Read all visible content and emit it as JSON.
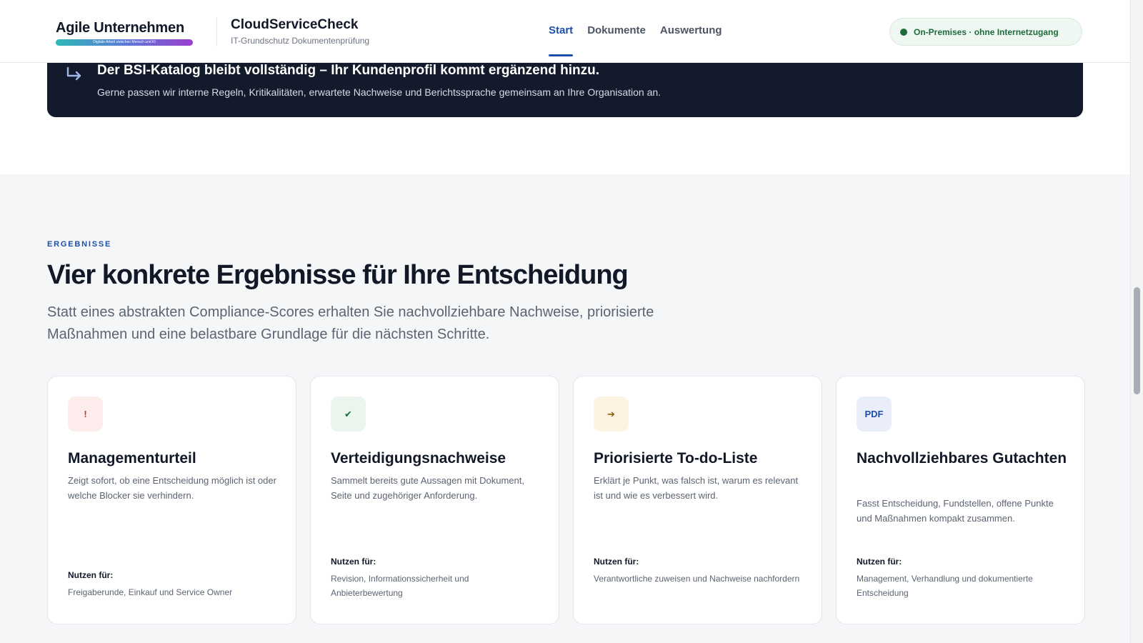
{
  "header": {
    "brand": {
      "name": "Agile Unternehmen",
      "tagline": "Digitale Arbeit zwischen Mensch und KI"
    },
    "product": {
      "name": "CloudServiceCheck",
      "subtitle": "IT-Grundschutz Dokumentenprüfung"
    },
    "nav": [
      {
        "label": "Start",
        "active": true
      },
      {
        "label": "Dokumente",
        "active": false
      },
      {
        "label": "Auswertung",
        "active": false
      }
    ],
    "status": {
      "label": "On-Premises · ohne Internetzugang",
      "color": "#1f6b3b"
    }
  },
  "banner": {
    "title": "Der BSI-Katalog bleibt vollständig – Ihr Kundenprofil kommt ergänzend hinzu.",
    "text": "Gerne passen wir interne Regeln, Kritikalitäten, erwartete Nachweise und Berichtssprache gemeinsam an Ihre Organisation an."
  },
  "results": {
    "eyebrow": "ERGEBNISSE",
    "title": "Vier konkrete Ergebnisse für Ihre Entscheidung",
    "lead": "Statt eines abstrakten Compliance-Scores erhalten Sie nachvollziehbare Nachweise, priorisierte Maßnahmen und eine belastbare Grundlage für die nächsten Schritte.",
    "cards": [
      {
        "icon": "!",
        "icon_name": "exclamation-icon",
        "icon_bg": "#fdecec",
        "icon_color": "#c0392b",
        "title": "Managementurteil",
        "description": "Zeigt sofort, ob eine Entscheidung möglich ist oder welche Blocker sie verhindern.",
        "use_label": "Nutzen für:",
        "use_text": "Freigaberunde, Einkauf und Service Owner"
      },
      {
        "icon": "✔",
        "icon_name": "check-icon",
        "icon_bg": "#eaf5ee",
        "icon_color": "#1f6b3b",
        "title": "Verteidigungsnachweise",
        "description": "Sammelt bereits gute Aussagen mit Dokument, Seite und zugehöriger Anforderung.",
        "use_label": "Nutzen für:",
        "use_text": "Revision, Informationssicherheit und Anbieterbewertung"
      },
      {
        "icon": "➔",
        "icon_name": "arrow-right-icon",
        "icon_bg": "#fdf3e3",
        "icon_color": "#8a5a12",
        "title": "Priorisierte To-do-Liste",
        "description": "Erklärt je Punkt, was falsch ist, warum es relevant ist und wie es verbessert wird.",
        "use_label": "Nutzen für:",
        "use_text": "Verantwortliche zuweisen und Nachweise nachfordern"
      },
      {
        "icon": "PDF",
        "icon_name": "pdf-icon",
        "icon_bg": "#e9eefa",
        "icon_color": "#1e4fa8",
        "title": "Nachvollziehbares Gutachten",
        "description": "Fasst Entscheidung, Fundstellen, offene Punkte und Maßnahmen kompakt zusammen.",
        "use_label": "Nutzen für:",
        "use_text": "Management, Verhandlung und dokumentierte Entscheidung"
      }
    ]
  }
}
